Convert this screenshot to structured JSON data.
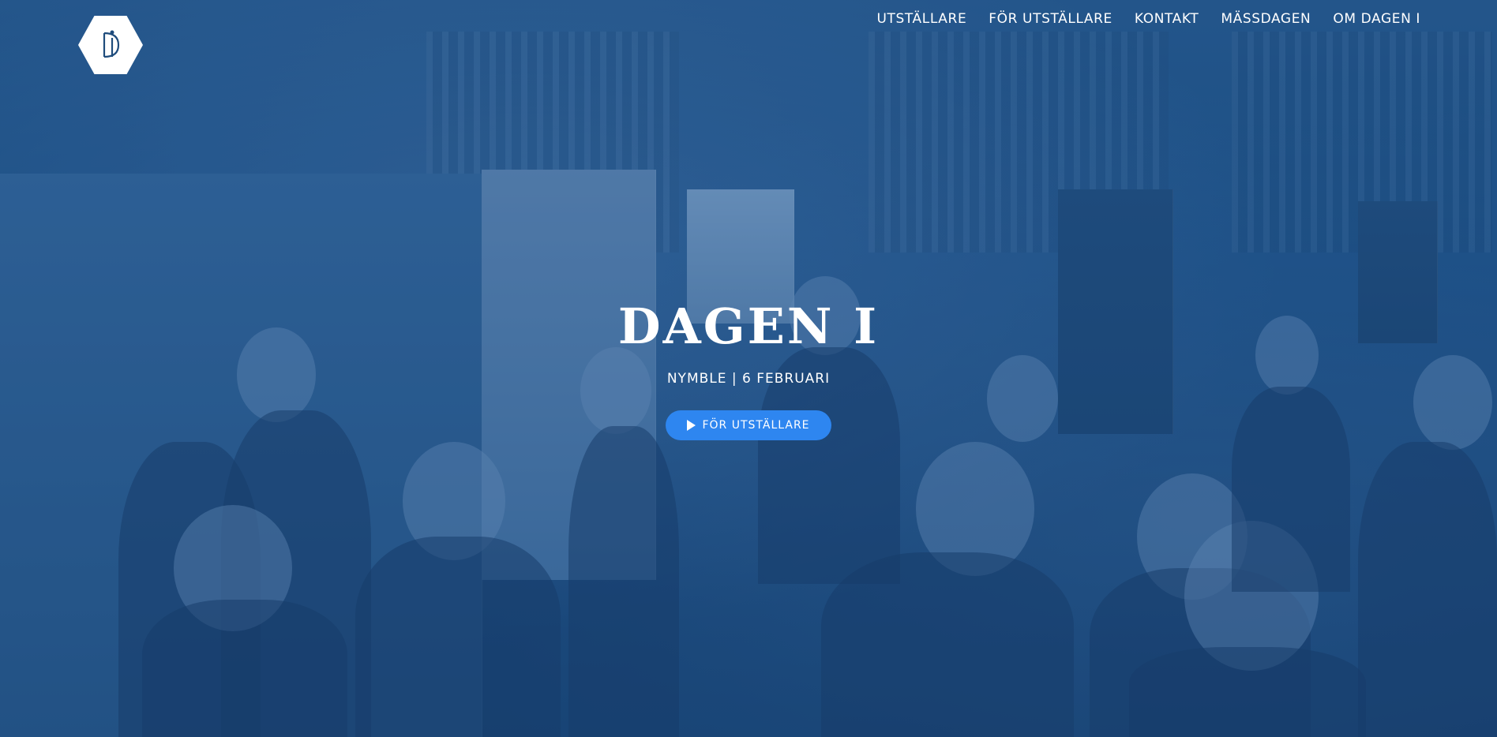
{
  "header": {
    "logo_icon": "hexagon-di-logo-icon",
    "nav": [
      {
        "label": "UTSTÄLLARE"
      },
      {
        "label": "FÖR UTSTÄLLARE"
      },
      {
        "label": "KONTAKT"
      },
      {
        "label": "MÄSSDAGEN"
      },
      {
        "label": "OM DAGEN I"
      }
    ]
  },
  "hero": {
    "title": "DAGEN I",
    "subtitle": "NYMBLE | 6 FEBRUARI",
    "cta": {
      "label": "FÖR UTSTÄLLARE",
      "icon": "play-icon"
    }
  },
  "colors": {
    "overlay": "#1f5287",
    "cta": "#2e86f0",
    "text": "#ffffff"
  }
}
